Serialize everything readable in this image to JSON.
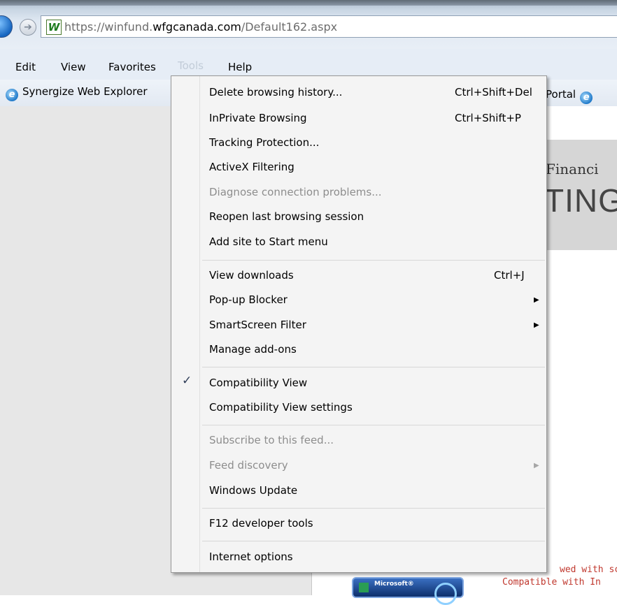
{
  "browser": {
    "url_prefix": "https://winfund.",
    "url_domain": "wfgcanada.com",
    "url_path": "/Default162.aspx"
  },
  "menubar": {
    "items": [
      "Edit",
      "View",
      "Favorites",
      "Tools",
      "Help"
    ]
  },
  "favorites": {
    "left_item": "Synergize Web Explorer",
    "right_item": "Portal"
  },
  "tools_menu": {
    "groups": [
      [
        {
          "label": "Delete browsing history...",
          "shortcut": "Ctrl+Shift+Del"
        },
        {
          "label": "InPrivate Browsing",
          "shortcut": "Ctrl+Shift+P"
        },
        {
          "label": "Tracking Protection...",
          "shortcut": ""
        },
        {
          "label": "ActiveX Filtering",
          "shortcut": ""
        },
        {
          "label": "Diagnose connection problems...",
          "shortcut": "",
          "disabled": true
        },
        {
          "label": "Reopen last browsing session",
          "shortcut": ""
        },
        {
          "label": "Add site to Start menu",
          "shortcut": ""
        }
      ],
      [
        {
          "label": "View downloads",
          "shortcut": "Ctrl+J"
        },
        {
          "label": "Pop-up Blocker",
          "submenu": true
        },
        {
          "label": "SmartScreen Filter",
          "submenu": true
        },
        {
          "label": "Manage add-ons"
        }
      ],
      [
        {
          "label": "Compatibility View",
          "checked": true
        },
        {
          "label": "Compatibility View settings"
        }
      ],
      [
        {
          "label": "Subscribe to this feed...",
          "disabled": true
        },
        {
          "label": "Feed discovery",
          "disabled": true,
          "submenu": true
        },
        {
          "label": "Windows Update"
        }
      ],
      [
        {
          "label": "F12 developer tools"
        }
      ],
      [
        {
          "label": "Internet options"
        }
      ]
    ]
  },
  "page": {
    "banner_line1": "Financi",
    "banner_line2": "TING",
    "footer_line1": "wed with sc",
    "footer_line2": "Compatible with In",
    "badge_text": "Microsoft®"
  },
  "colors": {
    "menu_bg": "#f4f4f4",
    "disabled_text": "#8d8d8d",
    "footer_red": "#c0382e"
  }
}
